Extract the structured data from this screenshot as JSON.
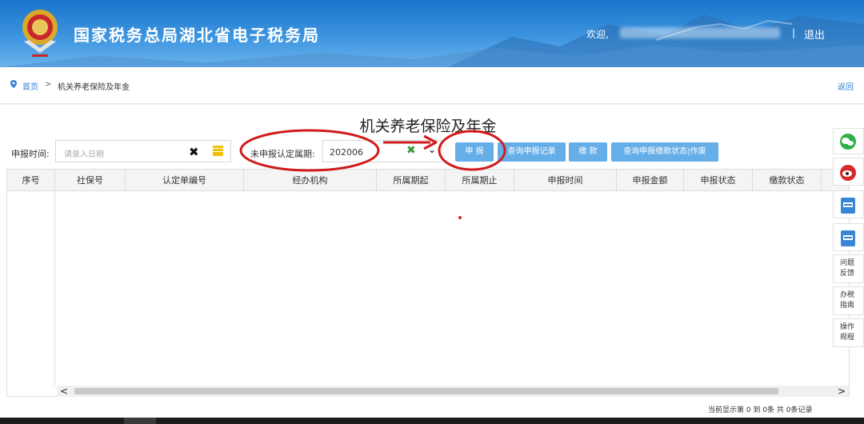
{
  "header": {
    "title": "国家税务总局湖北省电子税务局",
    "welcome": "欢迎,",
    "separator": "|",
    "logout": "退出"
  },
  "breadcrumb": {
    "home": "首页",
    "arrow": ">",
    "current": "机关养老保险及年金",
    "back": "返回"
  },
  "page_title": "机关养老保险及年金",
  "filters": {
    "date_label": "申报时间:",
    "date_placeholder": "请录入日期",
    "period_label": "未申报认定属期:",
    "period_value": "202006"
  },
  "buttons": {
    "declare": "申 报",
    "query_records": "查询申报记录",
    "pay": "缴 款",
    "query_status": "查询申报缴款状态|作废"
  },
  "table": {
    "columns": [
      "序号",
      "社保号",
      "认定单编号",
      "经办机构",
      "所属期起",
      "所属期止",
      "申报时间",
      "申报金额",
      "申报状态",
      "缴款状态"
    ]
  },
  "pagination": {
    "status": "当前显示第  0 到  0条  共  0条记录"
  },
  "side_float": {
    "items": [
      {
        "icon": "wechat-icon"
      },
      {
        "icon": "weibo-icon"
      },
      {
        "icon": "app-icon"
      },
      {
        "icon": "app-icon"
      },
      {
        "label": "问题反馈"
      },
      {
        "label": "办税指南"
      },
      {
        "label": "操作规程"
      }
    ]
  },
  "colors": {
    "header_blue": "#1a73c9",
    "button_blue": "#66aee8",
    "link_blue": "#2f7fd1",
    "annotation_red": "#d11a1a"
  }
}
